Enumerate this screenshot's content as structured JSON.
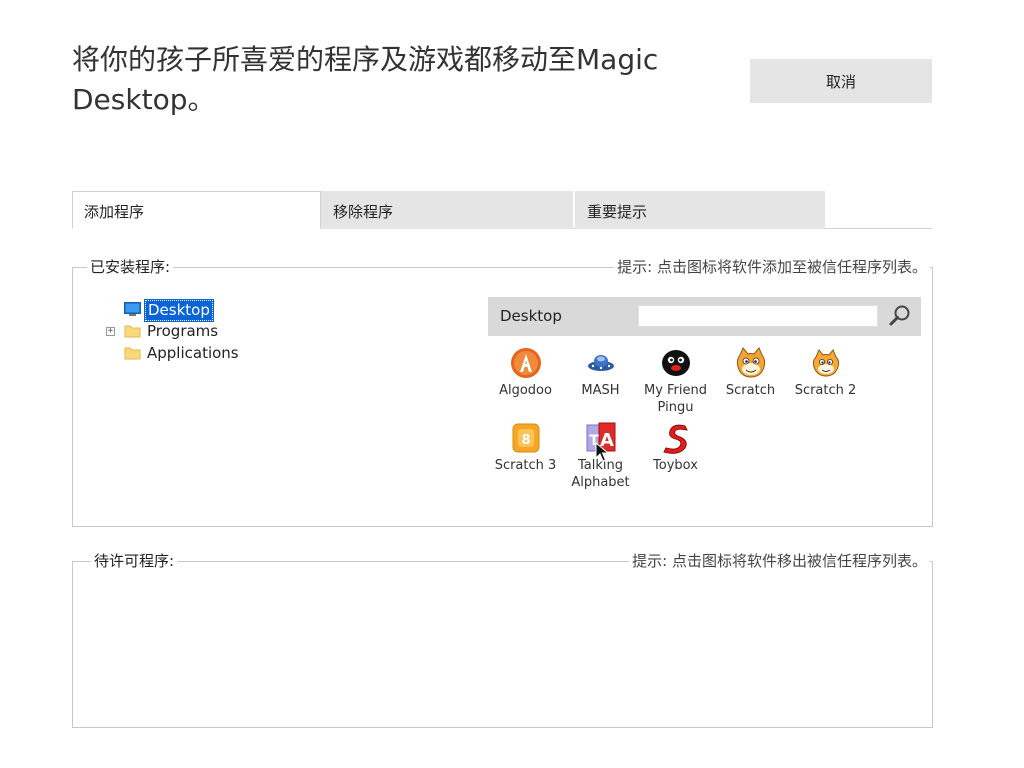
{
  "header": {
    "title": "将你的孩子所喜爱的程序及游戏都移动至Magic Desktop。",
    "cancel_label": "取消"
  },
  "tabs": [
    {
      "label": "添加程序",
      "active": true
    },
    {
      "label": "移除程序",
      "active": false
    },
    {
      "label": "重要提示",
      "active": false
    }
  ],
  "installed": {
    "title": "已安装程序:",
    "hint": "提示: 点击图标将软件添加至被信任程序列表。",
    "tree": [
      {
        "label": "Desktop",
        "icon": "desktop-icon",
        "selected": true,
        "expander": ""
      },
      {
        "label": "Programs",
        "icon": "folder-icon",
        "selected": false,
        "expander": "+"
      },
      {
        "label": "Applications",
        "icon": "folder-icon",
        "selected": false,
        "expander": ""
      }
    ],
    "panel": {
      "title": "Desktop",
      "search_placeholder": ""
    },
    "apps": [
      {
        "label": "Algodoo",
        "icon": "algodoo-icon"
      },
      {
        "label": "MASH",
        "icon": "mash-icon"
      },
      {
        "label": "My Friend Pingu",
        "icon": "pingu-icon"
      },
      {
        "label": "Scratch",
        "icon": "scratch-icon"
      },
      {
        "label": "Scratch 2",
        "icon": "scratch2-icon"
      },
      {
        "label": "Scratch 3",
        "icon": "scratch3-icon"
      },
      {
        "label": "Talking Alphabet",
        "icon": "talking-alphabet-icon"
      },
      {
        "label": "Toybox",
        "icon": "toybox-icon"
      }
    ]
  },
  "pending": {
    "title": "待许可程序:",
    "hint": "提示: 点击图标将软件移出被信任程序列表。"
  },
  "colors": {
    "selection": "#0a64d6",
    "button_bg": "#e5e5e5",
    "panel_header": "#d9d9d9"
  }
}
